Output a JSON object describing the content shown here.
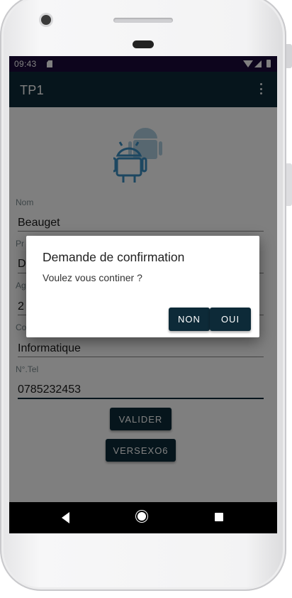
{
  "status_bar": {
    "time": "09:43"
  },
  "app_bar": {
    "title": "TP1"
  },
  "form": {
    "fields": [
      {
        "label": "Nom",
        "value": "Beauget"
      },
      {
        "label": "Pr",
        "value": "D"
      },
      {
        "label": "Ag",
        "value": "2"
      },
      {
        "label": "Co",
        "value": "Informatique"
      },
      {
        "label": "N°.Tel",
        "value": "0785232453"
      }
    ],
    "validate_label": "VALIDER",
    "versexo_label": "VERSEXO6"
  },
  "dialog": {
    "title": "Demande de confirmation",
    "message": "Voulez vous continer ?",
    "no_label": "NON",
    "yes_label": "OUI"
  },
  "colors": {
    "primary": "#0d2a38",
    "status_bar": "#1b0a3a",
    "logo": "#3a8fc3"
  }
}
